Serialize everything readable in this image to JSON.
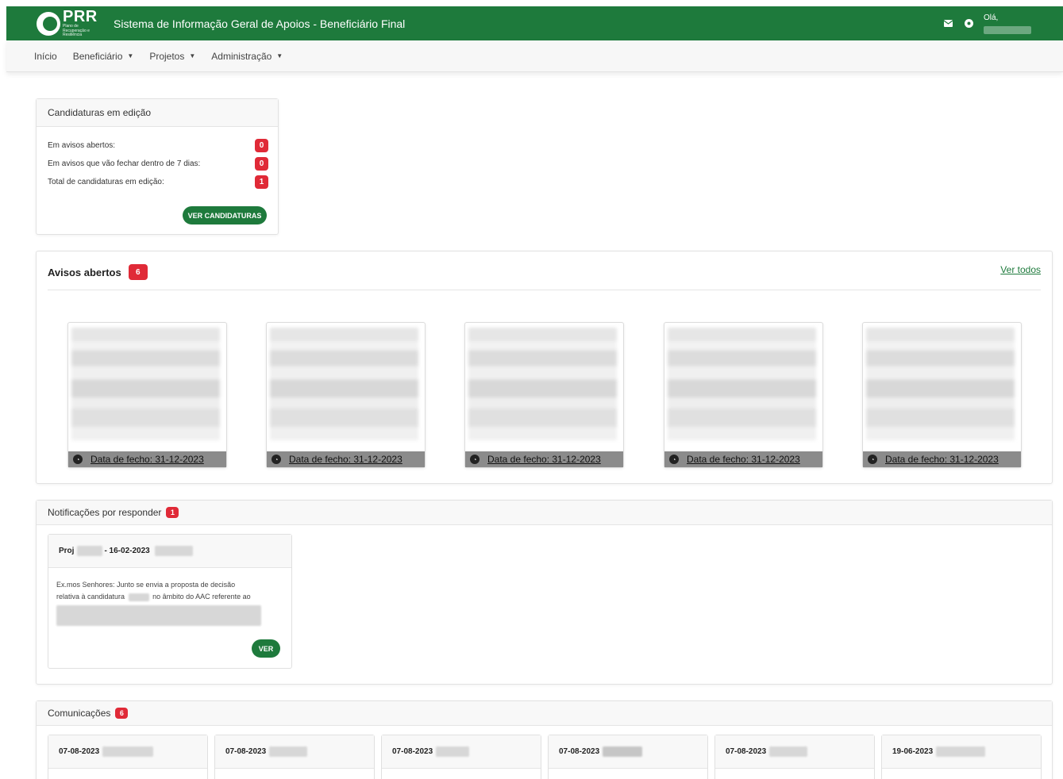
{
  "header": {
    "logo_text": "PRR",
    "logo_subtext": "Plano de Recuperação e Resiliência",
    "title": "Sistema de Informação Geral de Apoios - Beneficiário Final",
    "greeting": "Olá, ",
    "colors": {
      "brand": "#1e7a3c",
      "badge": "#e02a37"
    },
    "icons": [
      "envelope-icon",
      "user-icon"
    ]
  },
  "nav": {
    "items": [
      {
        "label": "Início",
        "dropdown": false
      },
      {
        "label": "Beneficiário",
        "dropdown": true
      },
      {
        "label": "Projetos",
        "dropdown": true
      },
      {
        "label": "Administração",
        "dropdown": true
      }
    ]
  },
  "candidaturas": {
    "title": "Candidaturas em edição",
    "rows": [
      {
        "label": "Em avisos abertos:",
        "count": "0"
      },
      {
        "label": "Em avisos que vão fechar dentro de 7 dias:",
        "count": "0"
      },
      {
        "label": "Total de candidaturas em edição:",
        "count": "1"
      }
    ],
    "button": "VER CANDIDATURAS"
  },
  "avisos": {
    "title": "Avisos abertos",
    "count": "6",
    "link": "Ver todos",
    "items": [
      {
        "date": "Data de fecho: 31-12-2023"
      },
      {
        "date": "Data de fecho: 31-12-2023"
      },
      {
        "date": "Data de fecho: 31-12-2023"
      },
      {
        "date": "Data de fecho: 31-12-2023"
      },
      {
        "date": "Data de fecho: 31-12-2023"
      }
    ]
  },
  "notificacoes": {
    "title": "Notificações por responder",
    "count": "1",
    "item": {
      "proj_prefix": "Proj",
      "date": "- 16-02-2023",
      "body_line1": "Ex.mos Senhores: Junto se envia a proposta de decisão",
      "body_line2a": "relativa à candidatura",
      "body_line2b": "no âmbito do AAC referente ao",
      "button": "VER"
    }
  },
  "comunicacoes": {
    "title": "Comunicações",
    "count": "6",
    "items": [
      {
        "date": "07-08-2023"
      },
      {
        "date": "07-08-2023"
      },
      {
        "date": "07-08-2023"
      },
      {
        "date": "07-08-2023"
      },
      {
        "date": "07-08-2023"
      },
      {
        "date": "19-06-2023"
      }
    ]
  }
}
